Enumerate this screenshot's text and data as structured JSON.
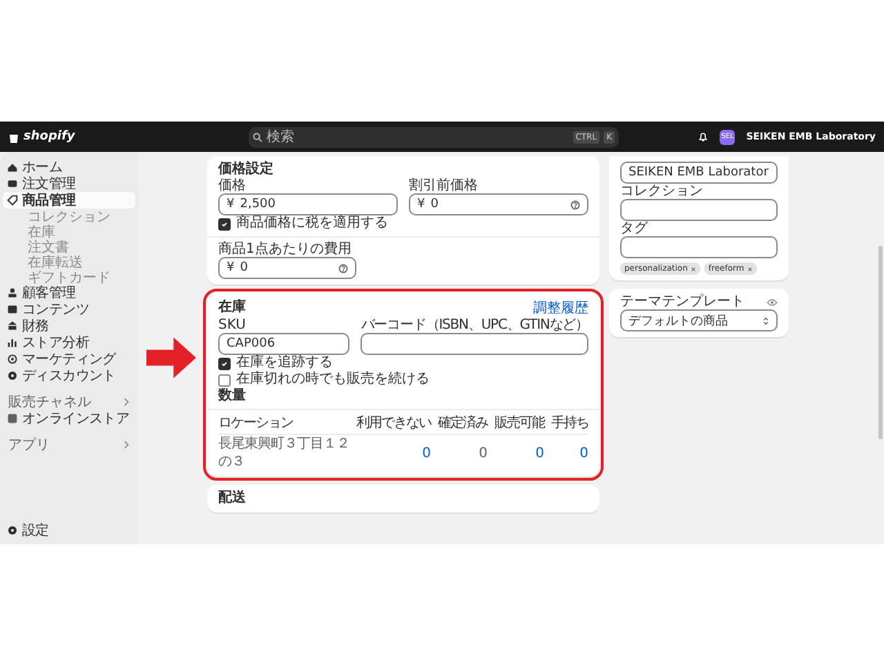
{
  "topbar": {
    "logo": "shopify",
    "search": {
      "placeholder": "検索",
      "keys": [
        "CTRL",
        "K"
      ]
    },
    "avatar": "SEL",
    "store": "SEIKEN EMB Laboratory"
  },
  "sidebar": {
    "items": [
      {
        "label": "ホーム",
        "selected": false
      },
      {
        "label": "注文管理",
        "selected": false
      },
      {
        "label": "商品管理",
        "selected": true,
        "children": [
          {
            "label": "コレクション",
            "selected": false
          },
          {
            "label": "在庫",
            "selected": false
          },
          {
            "label": "注文書",
            "selected": false
          },
          {
            "label": "在庫転送",
            "selected": false
          },
          {
            "label": "ギフトカード",
            "selected": false
          }
        ]
      },
      {
        "label": "顧客管理",
        "selected": false
      },
      {
        "label": "コンテンツ",
        "selected": false
      },
      {
        "label": "財務",
        "selected": false
      },
      {
        "label": "ストア分析",
        "selected": false
      },
      {
        "label": "マーケティング",
        "selected": false
      },
      {
        "label": "ディスカウント",
        "selected": false
      }
    ],
    "sections": [
      {
        "title": "販売チャネル",
        "items": [
          {
            "label": "オンラインストア",
            "selected": false
          }
        ]
      },
      {
        "title": "アプリ"
      }
    ],
    "settings": "設定"
  },
  "pricing": {
    "title": "価格設定",
    "fields": [
      {
        "label": "価格",
        "prefix": "¥",
        "value": "2,500",
        "help": false
      },
      {
        "label": "割引前価格",
        "prefix": "¥",
        "value": "0",
        "help": true
      }
    ],
    "tax": {
      "label": "商品価格に税を適用する",
      "checked": true
    },
    "cost": {
      "label": "商品1点あたりの費用",
      "prefix": "¥",
      "value": "0",
      "help": true
    }
  },
  "inventory": {
    "title": "在庫",
    "highlighted": true,
    "link": "調整履歴",
    "sku": {
      "label": "SKU",
      "value": "CAP006"
    },
    "barcode": {
      "label": "バーコード（ISBN、UPC、GTINなど）"
    },
    "checkboxes": [
      {
        "label": "在庫を追跡する",
        "checked": true
      },
      {
        "label": "在庫切れの時でも販売を続ける",
        "checked": false
      }
    ],
    "quantity_title": "数量",
    "table": {
      "columns": [
        "ロケーション",
        "利用できない",
        "確定済み",
        "販売可能",
        "手持ち"
      ],
      "rows": [
        {
          "cells": [
            {
              "text": "長尾東興町３丁目１２の３",
              "link": false
            },
            {
              "text": "0",
              "link": true
            },
            {
              "text": "0",
              "link": false
            },
            {
              "text": "0",
              "link": true
            },
            {
              "text": "0",
              "link": true
            }
          ]
        }
      ]
    }
  },
  "shipping": {
    "title": "配送"
  },
  "organization": {
    "vendor": "SEIKEN EMB Laborator",
    "collection_label": "コレクション",
    "tags_label": "タグ",
    "tags": [
      "personalization",
      "freeform"
    ]
  },
  "theme": {
    "label": "テーマテンプレート",
    "value": "デフォルトの商品"
  }
}
